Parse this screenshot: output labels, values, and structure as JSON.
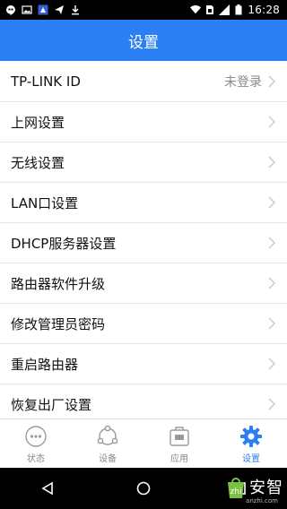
{
  "status_bar": {
    "time": "16:28",
    "left_icons": [
      "hangouts-icon",
      "image-icon",
      "app-icon",
      "send-icon",
      "download-icon"
    ],
    "right_icons": [
      "wifi-icon",
      "sim-icon",
      "signal-icon",
      "battery-icon"
    ]
  },
  "header": {
    "title": "设置"
  },
  "menu": {
    "items": [
      {
        "label": "TP-LINK ID",
        "value": "未登录"
      },
      {
        "label": "上网设置"
      },
      {
        "label": "无线设置"
      },
      {
        "label": "LAN口设置"
      },
      {
        "label": "DHCP服务器设置"
      },
      {
        "label": "路由器软件升级"
      },
      {
        "label": "修改管理员密码"
      },
      {
        "label": "重启路由器"
      },
      {
        "label": "恢复出厂设置"
      }
    ]
  },
  "tabs": {
    "items": [
      {
        "label": "状态",
        "icon": "status-icon"
      },
      {
        "label": "设备",
        "icon": "devices-icon"
      },
      {
        "label": "应用",
        "icon": "apps-icon"
      },
      {
        "label": "设置",
        "icon": "gear-icon",
        "active": true
      }
    ]
  },
  "watermark": {
    "text": "安智",
    "sub": "anzhi.com"
  },
  "colors": {
    "accent": "#2a7ff2",
    "status_bar": "#000000",
    "divider": "#e6e6e6"
  }
}
